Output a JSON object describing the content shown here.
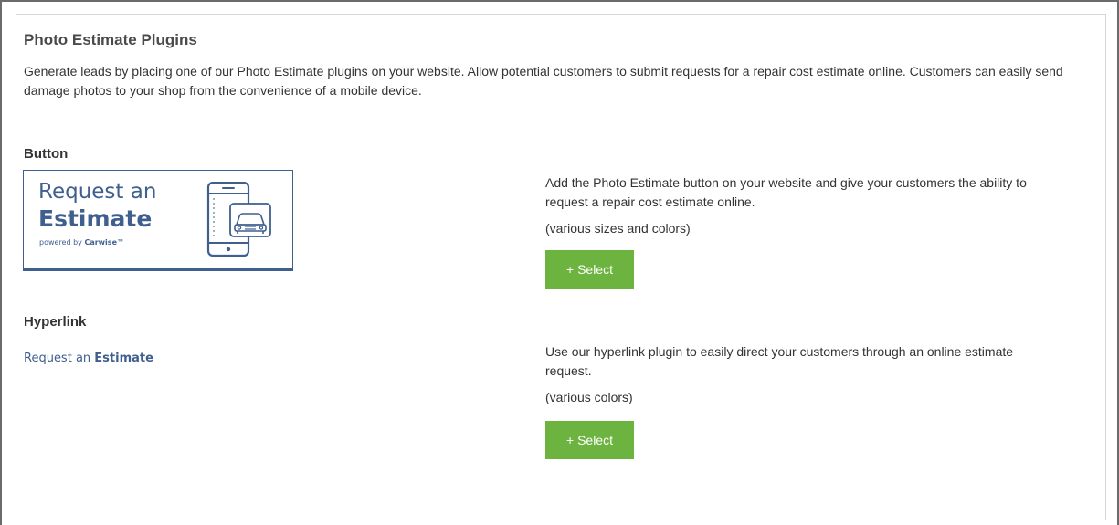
{
  "page": {
    "title": "Photo Estimate Plugins",
    "intro": "Generate leads by placing one of our Photo Estimate plugins on your website. Allow potential customers to submit requests for a repair cost estimate online. Customers can easily send damage photos to your shop from the convenience of a mobile device."
  },
  "button_section": {
    "heading": "Button",
    "preview": {
      "line1": "Request an",
      "line2": "Estimate",
      "powered_prefix": "powered by ",
      "powered_brand": "Carwise™",
      "icon": "phone-car-icon"
    },
    "description": "Add the Photo Estimate button on your website and give your customers the ability to request a repair cost estimate online.",
    "note": "(various sizes and colors)",
    "select_label": "+ Select"
  },
  "hyperlink_section": {
    "heading": "Hyperlink",
    "preview": {
      "prefix": "Request an ",
      "bold": "Estimate"
    },
    "description": "Use our hyperlink plugin to easily direct your customers through an online estimate request.",
    "note": "(various colors)",
    "select_label": "+ Select"
  },
  "colors": {
    "brand_blue": "#3f5f8f",
    "select_green": "#6cb33f"
  }
}
